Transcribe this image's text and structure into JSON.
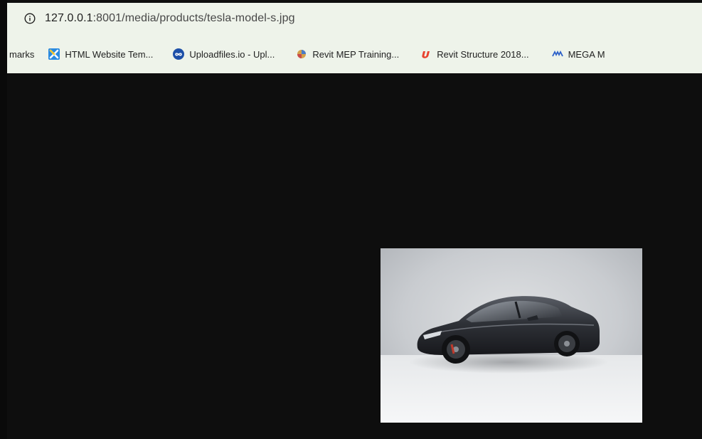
{
  "address_bar": {
    "url_host": "127.0.0.1",
    "url_rest": ":8001/media/products/tesla-model-s.jpg",
    "info_icon": "info-icon"
  },
  "bookmarks_bar": {
    "items": [
      {
        "label": "marks",
        "icon": null
      },
      {
        "label": "HTML Website Tem...",
        "icon": "blue-x-logo-icon"
      },
      {
        "label": "Uploadfiles.io - Upl...",
        "icon": "infinity-cloud-icon"
      },
      {
        "label": "Revit MEP Training...",
        "icon": "colorful-orb-icon"
      },
      {
        "label": "Revit Structure 2018...",
        "icon": "udemy-u-icon"
      },
      {
        "label": "MEGA M",
        "icon": "mega-logo-icon"
      }
    ]
  },
  "colors": {
    "page_background": "#0e0e0e",
    "browser_chrome": "#eef3ea",
    "text": "#1f1f1f"
  },
  "image": {
    "subject": "car-photo"
  }
}
